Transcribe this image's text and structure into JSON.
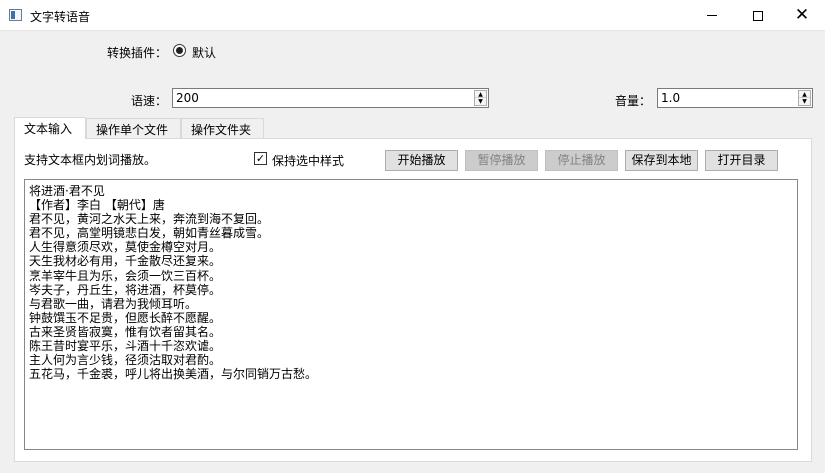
{
  "window": {
    "title": "文字转语音"
  },
  "plugin": {
    "label": "转换插件：",
    "option": "默认"
  },
  "speed": {
    "label": "语速：",
    "value": "200"
  },
  "volume": {
    "label": "音量：",
    "value": "1.0"
  },
  "tabs": [
    {
      "label": "文本输入",
      "active": true
    },
    {
      "label": "操作单个文件",
      "active": false
    },
    {
      "label": "操作文件夹",
      "active": false
    }
  ],
  "panel": {
    "hint": "支持文本框内划词播放。",
    "keep_style_label": "保持选中样式",
    "keep_style_checked": true,
    "buttons": {
      "start": "开始播放",
      "pause": "暂停播放",
      "stop": "停止播放",
      "save": "保存到本地",
      "open_dir": "打开目录"
    },
    "text_lines": [
      "将进酒·君不见",
      "【作者】李白 【朝代】唐",
      "君不见，黄河之水天上来，奔流到海不复回。",
      "君不见，高堂明镜悲白发，朝如青丝暮成雪。",
      "人生得意须尽欢，莫使金樽空对月。",
      "天生我材必有用，千金散尽还复来。",
      "烹羊宰牛且为乐，会须一饮三百杯。",
      "岑夫子，丹丘生，将进酒，杯莫停。",
      "与君歌一曲，请君为我倾耳听。",
      "钟鼓馔玉不足贵，但愿长醉不愿醒。",
      "古来圣贤皆寂寞，惟有饮者留其名。",
      "陈王昔时宴平乐，斗酒十千恣欢谑。",
      "主人何为言少钱，径须沽取对君酌。",
      "五花马，千金裘，呼儿将出换美酒，与尔同销万古愁。"
    ]
  }
}
